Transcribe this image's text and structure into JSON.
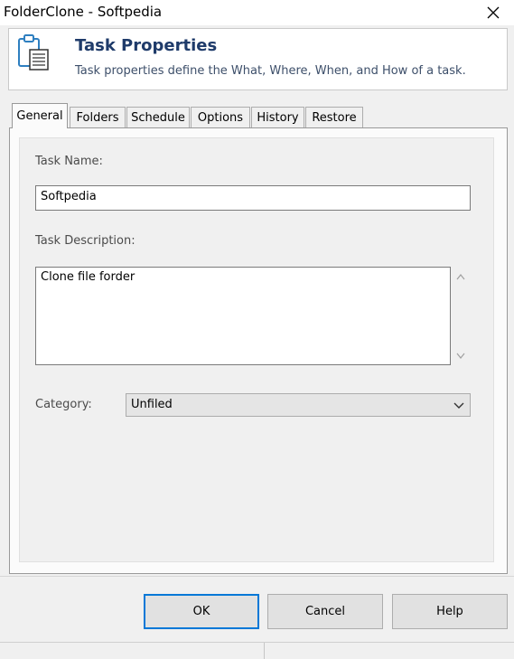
{
  "window": {
    "title": "FolderClone - Softpedia"
  },
  "header": {
    "title": "Task Properties",
    "subtitle": "Task properties define the What, Where, When, and How of a task.",
    "icon": "clipboard-list-icon"
  },
  "tabs": [
    {
      "label": "General",
      "active": true
    },
    {
      "label": "Folders",
      "active": false
    },
    {
      "label": "Schedule",
      "active": false
    },
    {
      "label": "Options",
      "active": false
    },
    {
      "label": "History",
      "active": false
    },
    {
      "label": "Restore",
      "active": false
    }
  ],
  "general": {
    "task_name_label": "Task Name:",
    "task_name_value": "Softpedia",
    "task_description_label": "Task Description:",
    "task_description_value": "Clone file forder",
    "category_label": "Category:",
    "category_value": "Unfiled"
  },
  "buttons": {
    "ok": "OK",
    "cancel": "Cancel",
    "help": "Help"
  },
  "colors": {
    "accent": "#0078d7",
    "header_title": "#1f3b6a"
  }
}
